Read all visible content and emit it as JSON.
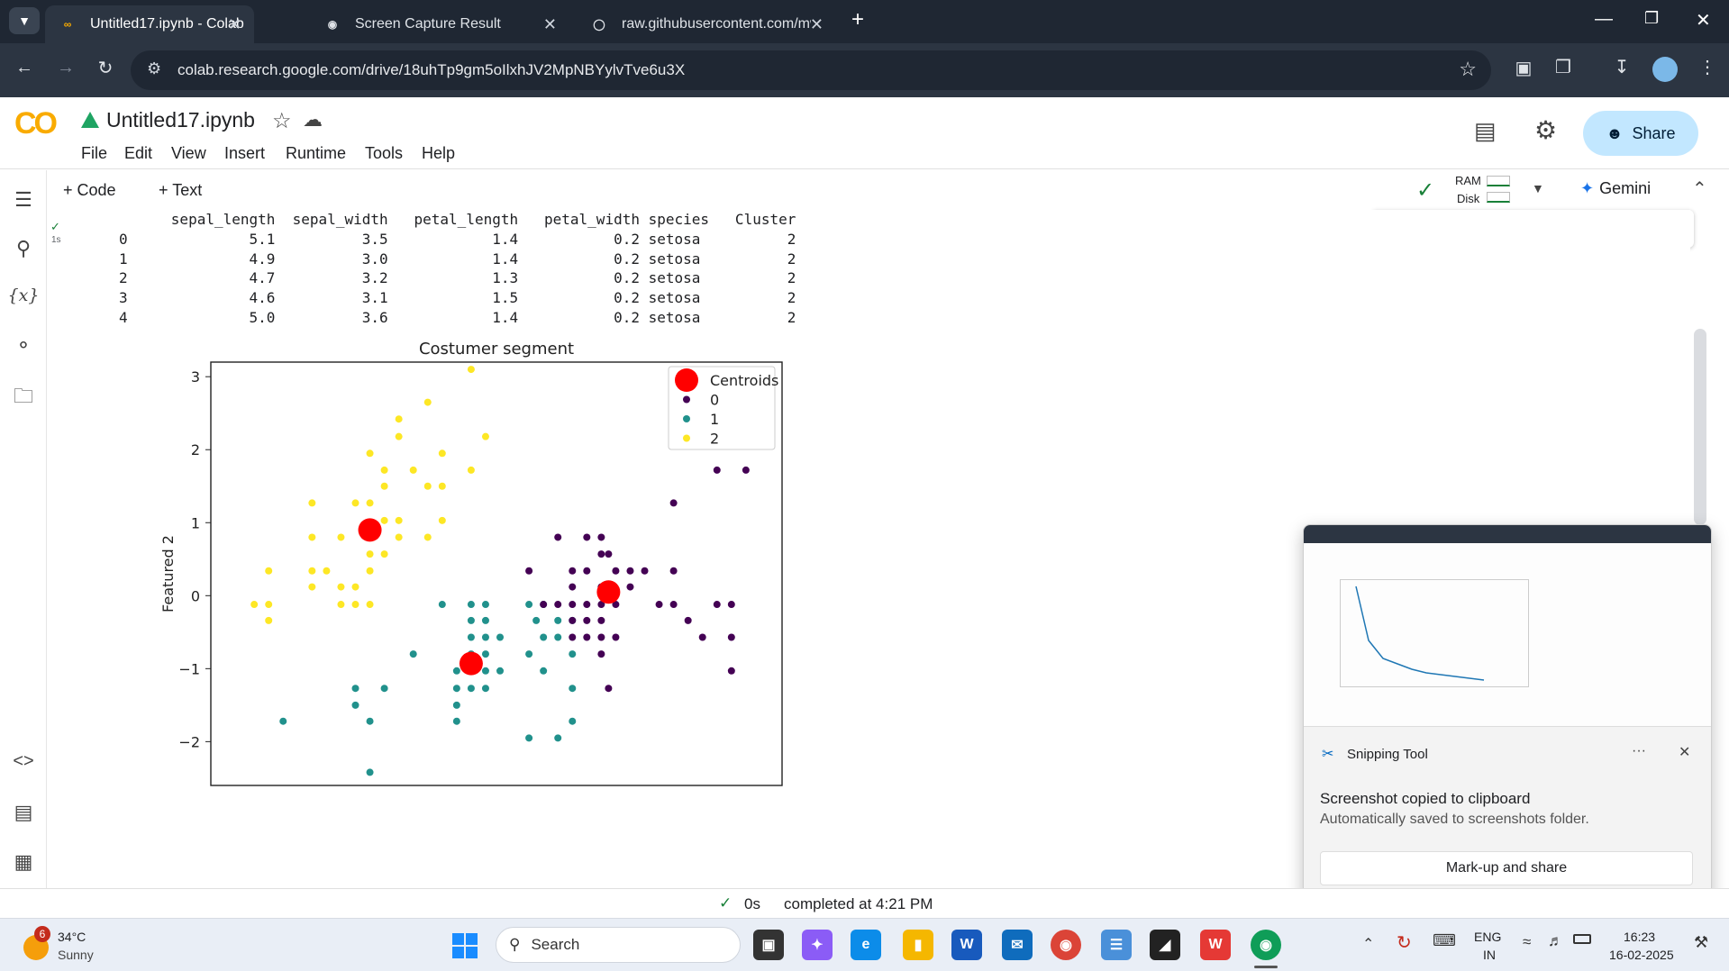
{
  "browser": {
    "tabs": [
      {
        "title": "Untitled17.ipynb - Colab",
        "icon": "colab-icon",
        "active": true
      },
      {
        "title": "Screen Capture Result",
        "icon": "camera-icon",
        "active": false
      },
      {
        "title": "raw.githubusercontent.com/mw",
        "icon": "globe-icon",
        "active": false
      }
    ],
    "url": "colab.research.google.com/drive/18uhTp9gm5oIlxhJV2MpNBYylvTve6u3X"
  },
  "colab": {
    "logo": "CO",
    "notebook_title": "Untitled17.ipynb",
    "menu": [
      "File",
      "Edit",
      "View",
      "Insert",
      "Runtime",
      "Tools",
      "Help"
    ],
    "share_label": "Share",
    "add_code": "+ Code",
    "add_text": "+ Text",
    "ram_label": "RAM",
    "disk_label": "Disk",
    "gemini_label": "Gemini",
    "exec_time": "1s"
  },
  "dataframe": {
    "columns": [
      "",
      "sepal_length",
      "sepal_width",
      "petal_length",
      "petal_width",
      "species",
      "Cluster"
    ],
    "rows": [
      [
        "0",
        "5.1",
        "3.5",
        "1.4",
        "0.2",
        "setosa",
        "2"
      ],
      [
        "1",
        "4.9",
        "3.0",
        "1.4",
        "0.2",
        "setosa",
        "2"
      ],
      [
        "2",
        "4.7",
        "3.2",
        "1.3",
        "0.2",
        "setosa",
        "2"
      ],
      [
        "3",
        "4.6",
        "3.1",
        "1.5",
        "0.2",
        "setosa",
        "2"
      ],
      [
        "4",
        "5.0",
        "3.6",
        "1.4",
        "0.2",
        "setosa",
        "2"
      ]
    ]
  },
  "chart_data": {
    "type": "scatter",
    "title": "Costumer segment",
    "xlabel": "",
    "ylabel": "Featured 2",
    "ylim": [
      -2.6,
      3.2
    ],
    "xlim": [
      -3.5,
      4.4
    ],
    "yticks": [
      3,
      2,
      1,
      0,
      -1,
      -2
    ],
    "legend_placement": "top-right",
    "colors": {
      "centroids": "#ff0000",
      "0": "#440154",
      "1": "#21918c",
      "2": "#fde725"
    },
    "series": [
      {
        "name": "Centroids",
        "points": [
          [
            -1.3,
            0.9
          ],
          [
            0.1,
            -0.93
          ],
          [
            2.0,
            0.05
          ]
        ]
      },
      {
        "name": "0",
        "points": [
          [
            1.3,
            0.8
          ],
          [
            1.7,
            0.8
          ],
          [
            1.9,
            0.8
          ],
          [
            1.9,
            0.57
          ],
          [
            2.0,
            0.57
          ],
          [
            2.9,
            1.27
          ],
          [
            3.5,
            1.72
          ],
          [
            3.9,
            1.72
          ],
          [
            0.9,
            0.34
          ],
          [
            1.5,
            0.34
          ],
          [
            1.7,
            0.34
          ],
          [
            2.1,
            0.34
          ],
          [
            2.3,
            0.34
          ],
          [
            2.5,
            0.34
          ],
          [
            2.9,
            0.34
          ],
          [
            1.5,
            0.12
          ],
          [
            1.9,
            0.12
          ],
          [
            2.3,
            0.12
          ],
          [
            1.7,
            -0.12
          ],
          [
            1.9,
            -0.12
          ],
          [
            2.1,
            -0.12
          ],
          [
            2.7,
            -0.12
          ],
          [
            2.9,
            -0.12
          ],
          [
            3.5,
            -0.12
          ],
          [
            3.7,
            -0.12
          ],
          [
            1.5,
            -0.12
          ],
          [
            1.3,
            -0.12
          ],
          [
            1.1,
            -0.12
          ],
          [
            1.9,
            -0.34
          ],
          [
            1.7,
            -0.34
          ],
          [
            1.5,
            -0.34
          ],
          [
            3.1,
            -0.34
          ],
          [
            1.7,
            -0.57
          ],
          [
            1.9,
            -0.57
          ],
          [
            1.5,
            -0.57
          ],
          [
            2.1,
            -0.57
          ],
          [
            3.3,
            -0.57
          ],
          [
            3.7,
            -0.57
          ],
          [
            1.9,
            -0.8
          ],
          [
            3.7,
            -1.03
          ],
          [
            2.0,
            -1.27
          ]
        ]
      },
      {
        "name": "1",
        "points": [
          [
            -0.3,
            -0.12
          ],
          [
            0.1,
            -0.12
          ],
          [
            0.3,
            -0.12
          ],
          [
            0.9,
            -0.12
          ],
          [
            1.1,
            -0.12
          ],
          [
            0.1,
            -0.34
          ],
          [
            0.3,
            -0.34
          ],
          [
            1.0,
            -0.34
          ],
          [
            1.3,
            -0.34
          ],
          [
            1.5,
            -0.34
          ],
          [
            0.1,
            -0.57
          ],
          [
            0.3,
            -0.57
          ],
          [
            0.5,
            -0.57
          ],
          [
            1.1,
            -0.57
          ],
          [
            1.3,
            -0.57
          ],
          [
            0.1,
            -0.8
          ],
          [
            0.3,
            -0.8
          ],
          [
            0.9,
            -0.8
          ],
          [
            1.5,
            -0.8
          ],
          [
            -0.7,
            -0.8
          ],
          [
            0.3,
            -1.03
          ],
          [
            0.5,
            -1.03
          ],
          [
            1.1,
            -1.03
          ],
          [
            -0.1,
            -1.03
          ],
          [
            -1.5,
            -1.27
          ],
          [
            -1.1,
            -1.27
          ],
          [
            -0.1,
            -1.27
          ],
          [
            0.1,
            -1.27
          ],
          [
            0.3,
            -1.27
          ],
          [
            1.5,
            -1.27
          ],
          [
            -1.5,
            -1.5
          ],
          [
            -0.1,
            -1.5
          ],
          [
            -2.5,
            -1.72
          ],
          [
            -1.3,
            -1.72
          ],
          [
            -0.1,
            -1.72
          ],
          [
            1.5,
            -1.72
          ],
          [
            0.9,
            -1.95
          ],
          [
            1.3,
            -1.95
          ],
          [
            -1.3,
            -2.42
          ]
        ]
      },
      {
        "name": "2",
        "points": [
          [
            0.1,
            3.1
          ],
          [
            -0.5,
            2.65
          ],
          [
            -0.9,
            2.42
          ],
          [
            -0.3,
            1.95
          ],
          [
            -1.3,
            1.95
          ],
          [
            -0.9,
            2.18
          ],
          [
            0.3,
            2.18
          ],
          [
            -1.1,
            1.72
          ],
          [
            -0.7,
            1.72
          ],
          [
            0.1,
            1.72
          ],
          [
            -1.1,
            1.5
          ],
          [
            -0.5,
            1.5
          ],
          [
            -0.3,
            1.5
          ],
          [
            -2.1,
            1.27
          ],
          [
            -1.5,
            1.27
          ],
          [
            -1.3,
            1.27
          ],
          [
            -1.1,
            1.03
          ],
          [
            -0.9,
            1.03
          ],
          [
            -0.3,
            1.03
          ],
          [
            -0.9,
            0.8
          ],
          [
            -0.5,
            0.8
          ],
          [
            -1.7,
            0.8
          ],
          [
            -2.1,
            0.8
          ],
          [
            -1.1,
            0.57
          ],
          [
            -1.3,
            0.57
          ],
          [
            -2.7,
            0.34
          ],
          [
            -2.1,
            0.34
          ],
          [
            -1.9,
            0.34
          ],
          [
            -1.3,
            0.34
          ],
          [
            -2.1,
            0.12
          ],
          [
            -1.5,
            0.12
          ],
          [
            -1.7,
            0.12
          ],
          [
            -2.9,
            -0.12
          ],
          [
            -2.7,
            -0.12
          ],
          [
            -1.7,
            -0.12
          ],
          [
            -1.5,
            -0.12
          ],
          [
            -1.3,
            -0.12
          ],
          [
            -2.7,
            -0.34
          ]
        ]
      }
    ]
  },
  "status": {
    "check": "✓",
    "time": "0s",
    "text": "completed at 4:21 PM"
  },
  "snipping": {
    "app": "Snipping Tool",
    "title": "Screenshot copied to clipboard",
    "subtitle": "Automatically saved to screenshots folder.",
    "action": "Mark-up and share"
  },
  "taskbar": {
    "weather_badge": "6",
    "temp": "34°C",
    "condition": "Sunny",
    "search": "Search",
    "lang1": "ENG",
    "lang2": "IN",
    "time": "16:23",
    "date": "16-02-2025"
  }
}
